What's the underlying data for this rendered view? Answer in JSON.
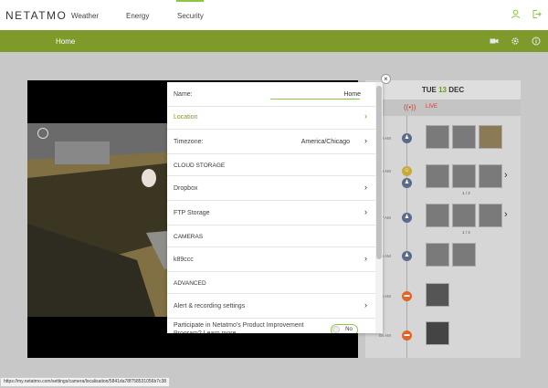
{
  "nav": {
    "logo": "NETATMO",
    "links": [
      "Weather",
      "Energy",
      "Security"
    ],
    "active": "Security"
  },
  "subnav": {
    "title": "Home"
  },
  "modal": {
    "name_label": "Name:",
    "name_value": "Home",
    "location_label": "Location",
    "timezone_label": "Timezone:",
    "timezone_value": "America/Chicago",
    "cloud_storage_header": "CLOUD STORAGE",
    "dropbox_label": "Dropbox",
    "ftp_label": "FTP Storage",
    "cameras_header": "CAMERAS",
    "camera_name": "k89ccc",
    "advanced_header": "ADVANCED",
    "alert_label": "Alert & recording settings",
    "participate_label": "Participate in Netatmo's Product Improvement Program? Learn more",
    "toggle_value": "No",
    "close_glyph": "×"
  },
  "timeline": {
    "day_name": "TUE",
    "day_number": "13",
    "month": "DEC",
    "live_label": "LIVE",
    "times": [
      "09 AM",
      "08 AM",
      "07 AM",
      "06 AM",
      "05 AM",
      "04 AM"
    ],
    "pager1": "1 / 2",
    "pager2": "1 / 4"
  },
  "status_url": "https://my.netatmo.com/settings/camera/localisation/5841da78f758531056b7c38",
  "colors": {
    "accent": "#8cc63f",
    "bar": "#7d9a2b",
    "live": "#d9362b",
    "event_blue": "#5b6a8a",
    "event_orange": "#e0652a"
  }
}
